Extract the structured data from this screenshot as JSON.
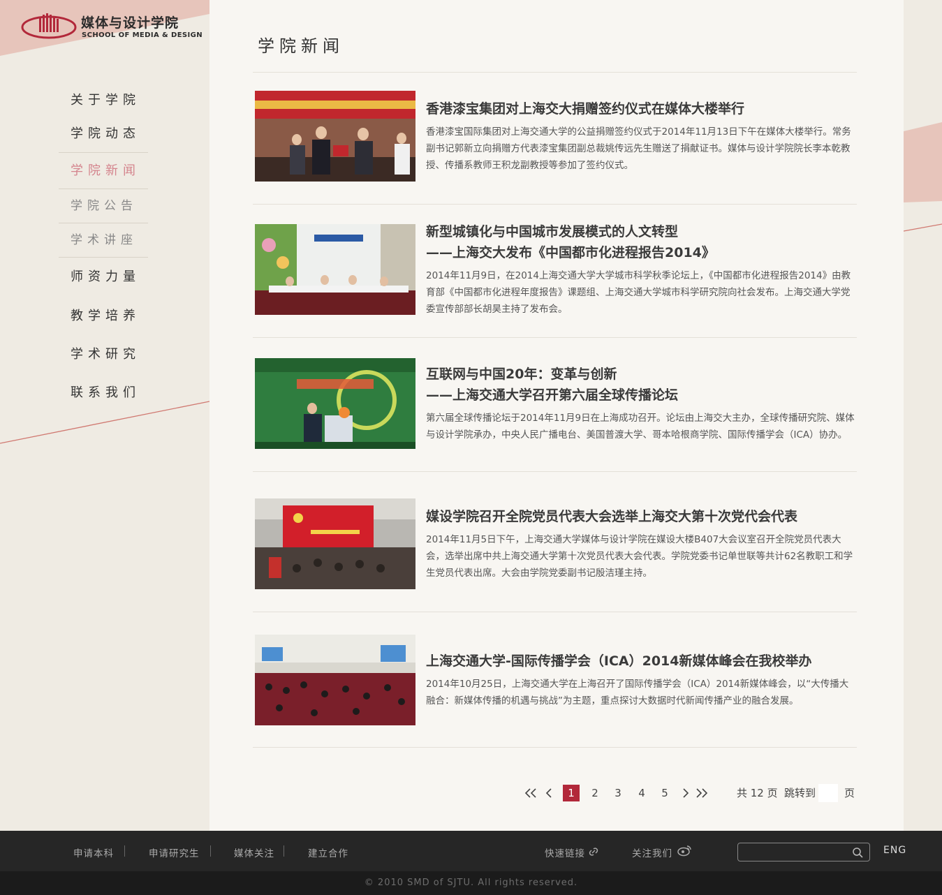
{
  "brand": {
    "name_cn": "媒体与设计学院",
    "name_en": "SCHOOL OF MEDIA & DESIGN",
    "accent_color": "#b2283a",
    "light_accent": "#d4848d"
  },
  "sidebar": {
    "items": [
      {
        "label": "关于学院",
        "state": "normal"
      },
      {
        "label": "学院动态",
        "state": "normal"
      },
      {
        "label": "学院新闻",
        "state": "active"
      },
      {
        "label": "学院公告",
        "state": "sub"
      },
      {
        "label": "学术讲座",
        "state": "sub"
      },
      {
        "label": "师资力量",
        "state": "normal"
      },
      {
        "label": "教学培养",
        "state": "normal"
      },
      {
        "label": "学术研究",
        "state": "normal"
      },
      {
        "label": "联系我们",
        "state": "normal"
      }
    ]
  },
  "main": {
    "title": "学院新闻",
    "news": [
      {
        "title": "香港漆宝集团对上海交大捐赠签约仪式在媒体大楼举行",
        "title2": "",
        "summary": "香港漆宝国际集团对上海交通大学的公益捐赠签约仪式于2014年11月13日下午在媒体大楼举行。常务副书记郭新立向捐赠方代表漆宝集团副总裁姚传远先生赠送了捐献证书。媒体与设计学院院长李本乾教授、传播系教师王积龙副教授等参加了签约仪式。",
        "image": "ceremony-photo"
      },
      {
        "title": "新型城镇化与中国城市发展模式的人文转型",
        "title2": "——上海交大发布《中国都市化进程报告2014》",
        "summary": "2014年11月9日，在2014上海交通大学大学城市科学秋季论坛上，《中国都市化进程报告2014》由教育部《中国都市化进程年度报告》课题组、上海交通大学城市科学研究院向社会发布。上海交通大学党委宣传部部长胡昊主持了发布会。",
        "image": "forum-panel-photo"
      },
      {
        "title": "互联网与中国20年：变革与创新",
        "title2": "——上海交通大学召开第六届全球传播论坛",
        "summary": "第六届全球传播论坛于2014年11月9日在上海成功召开。论坛由上海交大主办，全球传播研究院、媒体与设计学院承办，中央人民广播电台、美国普渡大学、哥本哈根商学院、国际传播学会（ICA）协办。",
        "image": "speaker-podium-photo"
      },
      {
        "title": "媒设学院召开全院党员代表大会选举上海交大第十次党代会代表",
        "title2": "",
        "summary": "2014年11月5日下午，上海交通大学媒体与设计学院在媒设大楼B407大会议室召开全院党员代表大会，选举出席中共上海交通大学第十次党员代表大会代表。学院党委书记单世联等共计62名教职工和学生党员代表出席。大会由学院党委副书记殷洁瑾主持。",
        "image": "party-meeting-photo"
      },
      {
        "title": "上海交通大学-国际传播学会（ICA）2014新媒体峰会在我校举办",
        "title2": "",
        "summary": "2014年10月25日，上海交通大学在上海召开了国际传播学会（ICA）2014新媒体峰会，以“大传播大融合：新媒体传播的机遇与挑战”为主题，重点探讨大数据时代新闻传播产业的融合发展。",
        "image": "auditorium-photo"
      }
    ]
  },
  "pagination": {
    "pages": [
      "1",
      "2",
      "3",
      "4",
      "5"
    ],
    "current": "1",
    "total_label": "共 12 页",
    "jump_label": "跳转到",
    "page_suffix": "页",
    "jump_value": ""
  },
  "footer": {
    "links": [
      "申请本科",
      "申请研究生",
      "媒体关注",
      "建立合作"
    ],
    "quick_links": "快速链接",
    "follow_us": "关注我们",
    "search_placeholder": "",
    "lang": "ENG",
    "copyright": "© 2010 SMD of SJTU. All rights reserved."
  }
}
